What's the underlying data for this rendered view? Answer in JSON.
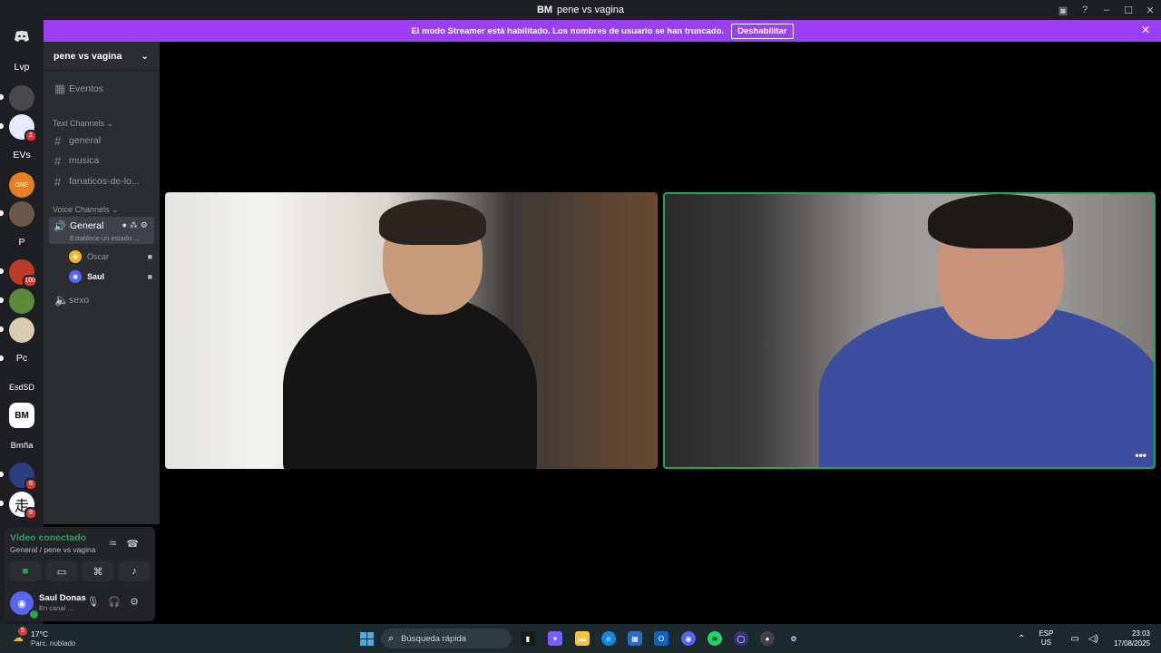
{
  "window": {
    "title": "pene vs vagina",
    "logo": "BM"
  },
  "banner": {
    "text": "El modo Streamer está habilitado. Los nombres de usuario se han truncado.",
    "button": "Deshabilitar"
  },
  "rail": {
    "servers": [
      {
        "label": "Lvp"
      },
      {
        "label": ""
      },
      {
        "label": "",
        "badge": "1"
      },
      {
        "label": "EVs"
      },
      {
        "label": "ONE"
      },
      {
        "label": ""
      },
      {
        "label": "P"
      },
      {
        "label": "",
        "badge": "100"
      },
      {
        "label": ""
      },
      {
        "label": ""
      },
      {
        "label": "Pc"
      },
      {
        "label": "EsdSD"
      },
      {
        "label": "BM"
      },
      {
        "label": "Bmña"
      },
      {
        "label": "",
        "badge": "8"
      },
      {
        "label": "走",
        "badge": "9"
      }
    ]
  },
  "sidebar": {
    "guild_name": "pene vs vagina",
    "events": "Eventos",
    "text_category": "Text Channels",
    "text_channels": [
      "general",
      "musica",
      "fanaticos-de-lo..."
    ],
    "voice_category": "Voice Channels",
    "active_voice": {
      "name": "General",
      "status": "Establece un estado ..."
    },
    "members": [
      {
        "name": "Oscar",
        "color": "#f0b232"
      },
      {
        "name": "Saul",
        "color": "#5865f2"
      }
    ],
    "other_voice": "sexo"
  },
  "voice_panel": {
    "title": "Vídeo conectado",
    "subtitle": "General / pene vs vagina"
  },
  "user": {
    "name": "Saul Donas",
    "status": "En canal ..."
  },
  "taskbar": {
    "temp": "17°C",
    "condition": "Parc. nublado",
    "weather_badge": "5",
    "search_placeholder": "Búsqueda rápida",
    "lang_top": "ESP",
    "lang_bottom": "US",
    "time": "23:03",
    "date": "17/08/2025"
  }
}
